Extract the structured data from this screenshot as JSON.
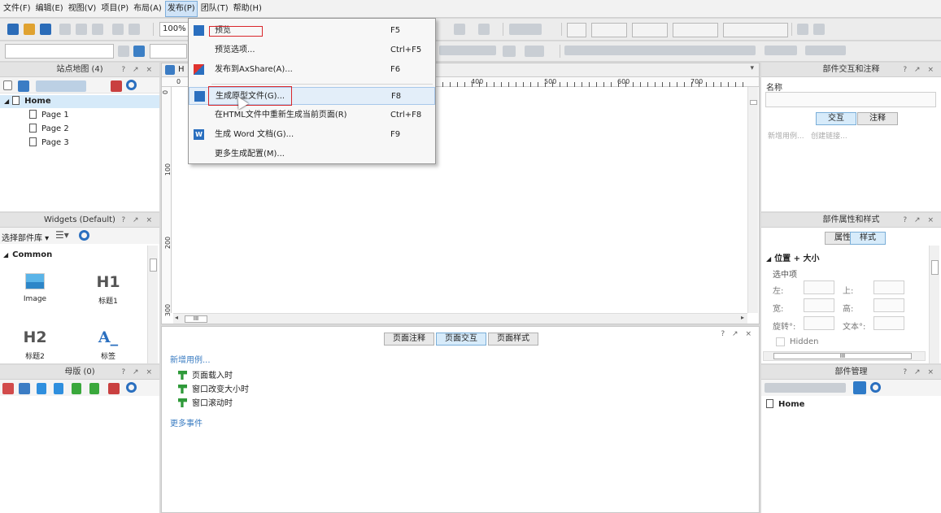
{
  "menubar": {
    "items": [
      "文件(F)",
      "编辑(E)",
      "视图(V)",
      "项目(P)",
      "布局(A)",
      "发布(P)",
      "团队(T)",
      "帮助(H)"
    ],
    "active_index": 5
  },
  "toolbar": {
    "zoom": "100%"
  },
  "publish_menu": {
    "items": [
      {
        "label": "预览",
        "shortcut": "F5",
        "icon": "play-icon",
        "highlight_box": true
      },
      {
        "label": "预览选项...",
        "shortcut": "Ctrl+F5",
        "icon": ""
      },
      {
        "label": "发布到AxShare(A)...",
        "shortcut": "F6",
        "icon": "axshare-icon"
      },
      {
        "label": "生成原型文件(G)...",
        "shortcut": "F8",
        "icon": "generate-prototype-icon",
        "hover": true,
        "highlight_box": true
      },
      {
        "label": "在HTML文件中重新生成当前页面(R)",
        "shortcut": "Ctrl+F8",
        "icon": ""
      },
      {
        "label": "生成 Word 文档(G)...",
        "shortcut": "F9",
        "icon": "word-icon"
      },
      {
        "label": "更多生成配置(M)...",
        "shortcut": "",
        "icon": ""
      }
    ]
  },
  "sitemap": {
    "title": "站点地图 (4)",
    "controls": "? ↗ ×",
    "root": "Home",
    "pages": [
      "Page 1",
      "Page 2",
      "Page 3"
    ]
  },
  "widgets": {
    "title": "Widgets (Default)",
    "controls": "? ↗ ×",
    "library_label": "选择部件库",
    "section": "Common",
    "items": [
      {
        "glyph": "",
        "label": "Image"
      },
      {
        "glyph": "H1",
        "label": "标题1"
      },
      {
        "glyph": "H2",
        "label": "标题2"
      },
      {
        "glyph": "A_",
        "label": "标签"
      }
    ]
  },
  "masters": {
    "title": "母版 (0)",
    "controls": "? ↗ ×"
  },
  "canvas": {
    "ruler_top": [
      "400",
      "500",
      "600",
      "700"
    ],
    "ruler_top_zero": "0",
    "ruler_left": [
      "0",
      "100",
      "200",
      "300"
    ],
    "page_tab": "H"
  },
  "page_props": {
    "controls": "? ↗ ×",
    "tabs": [
      "页面注释",
      "页面交互",
      "页面样式"
    ],
    "selected_tab": 1,
    "add_case": "新增用例...",
    "events": [
      "页面载入时",
      "窗口改变大小时",
      "窗口滚动时"
    ],
    "more_events": "更多事件"
  },
  "interactions_panel": {
    "title": "部件交互和注释",
    "controls": "? ↗ ×",
    "name_label": "名称",
    "tabs": [
      "交互",
      "注释"
    ],
    "hint": "新增用例...   创建链接..."
  },
  "style_panel": {
    "title": "部件属性和样式",
    "controls": "? ↗ ×",
    "tabs": [
      "属性",
      "样式"
    ],
    "section": "位置 + 大小",
    "selected_label": "选中项",
    "labels": [
      "左:",
      "上:",
      "宽:",
      "高:",
      "旋转°:",
      "文本°:"
    ],
    "hidden_label": "Hidden",
    "scroll_label": "III"
  },
  "outline_panel": {
    "title": "部件管理",
    "controls": "? ↗ ×",
    "root": "Home"
  },
  "colors": {
    "accent": "#3a7cc2",
    "highlight_box": "#d9262b",
    "hover_bg": "#e3eef9"
  }
}
